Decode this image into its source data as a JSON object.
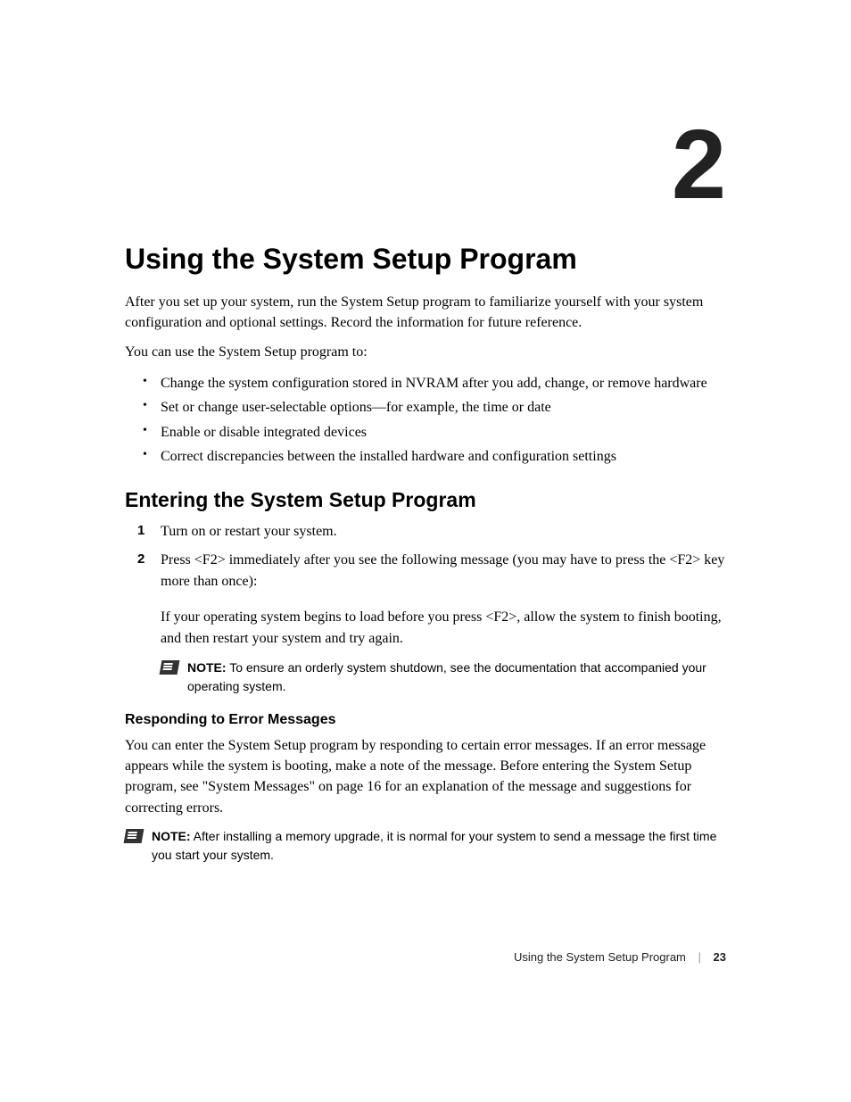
{
  "chapter": {
    "number": "2",
    "title": "Using the System Setup Program"
  },
  "intro": {
    "p1": "After you set up your system, run the System Setup program to familiarize yourself with your system configuration and optional settings. Record the information for future reference.",
    "p2": "You can use the System Setup program to:"
  },
  "bullets": [
    "Change the system configuration stored in NVRAM after you add, change, or remove hardware",
    "Set or change user-selectable options—for example, the time or date",
    "Enable or disable integrated devices",
    "Correct discrepancies between the installed hardware and configuration settings"
  ],
  "entering": {
    "heading": "Entering the System Setup Program",
    "steps": [
      "Turn on or restart your system.",
      "Press <F2> immediately after you see the following message (you may have to press the <F2> key more than once):"
    ],
    "step2_extra": "If your operating system begins to load before you press <F2>, allow the system to finish booting, and then restart your system and try again.",
    "note_label": "NOTE:",
    "note_body": " To ensure an orderly system shutdown, see the documentation that accompanied your operating system."
  },
  "responding": {
    "heading": "Responding to Error Messages",
    "body": "You can enter the System Setup program by responding to certain error messages. If an error message appears while the system is booting, make a note of the message. Before entering the System Setup program, see \"System Messages\" on page 16 for an explanation of the message and suggestions for correcting errors.",
    "note_label": "NOTE:",
    "note_body": " After installing a memory upgrade, it is normal for your system to send a message the first time you start your system."
  },
  "footer": {
    "section": "Using the System Setup Program",
    "page": "23"
  }
}
